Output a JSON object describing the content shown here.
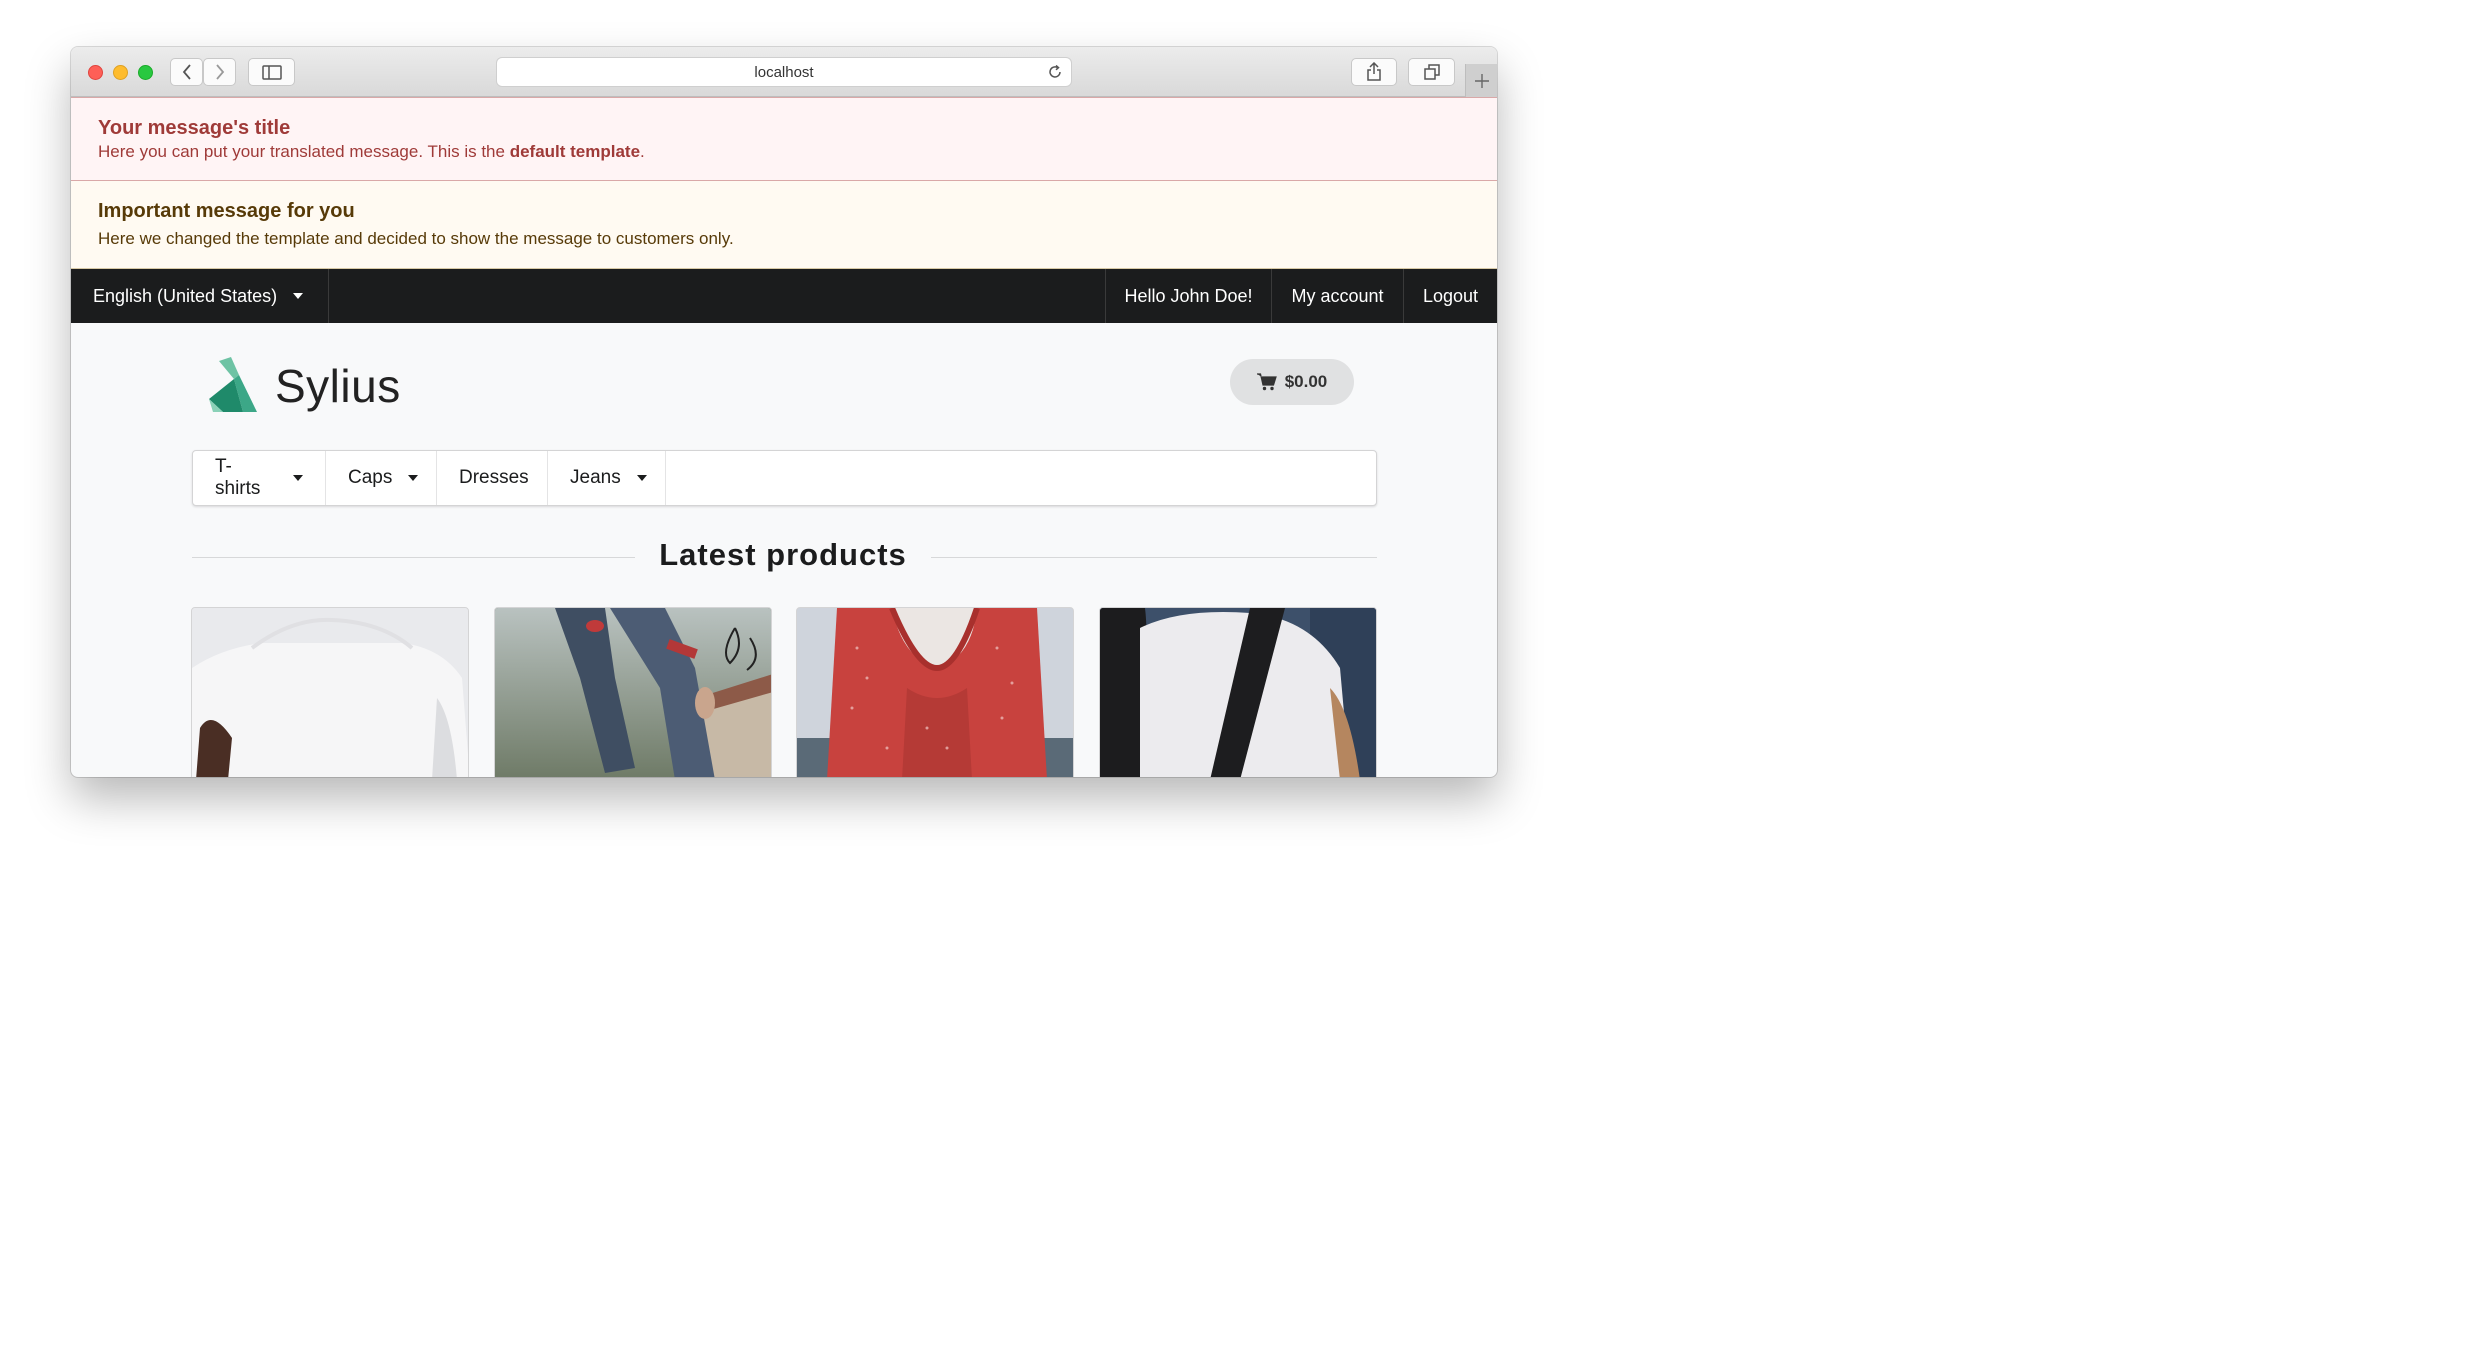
{
  "browser": {
    "url": "localhost"
  },
  "messages": {
    "error": {
      "title": "Your message's title",
      "body_prefix": "Here you can put your translated message. This is the ",
      "body_bold": "default template",
      "body_suffix": "."
    },
    "warning": {
      "title": "Important message for you",
      "body": "Here we changed the template and decided to show the message to customers only."
    }
  },
  "topnav": {
    "language": "English (United States)",
    "greeting": "Hello John Doe!",
    "my_account": "My account",
    "logout": "Logout"
  },
  "header": {
    "logo_text": "Sylius",
    "cart_total": "$0.00"
  },
  "menu": {
    "items": [
      {
        "label": "T-shirts"
      },
      {
        "label": "Caps"
      },
      {
        "label": "Dresses"
      },
      {
        "label": "Jeans"
      }
    ]
  },
  "latest": {
    "title": "Latest products"
  },
  "colors": {
    "accent": "#1abb9c",
    "error_text": "#9f3a38",
    "warning_text": "#573a08",
    "topbar": "#1b1c1d"
  }
}
